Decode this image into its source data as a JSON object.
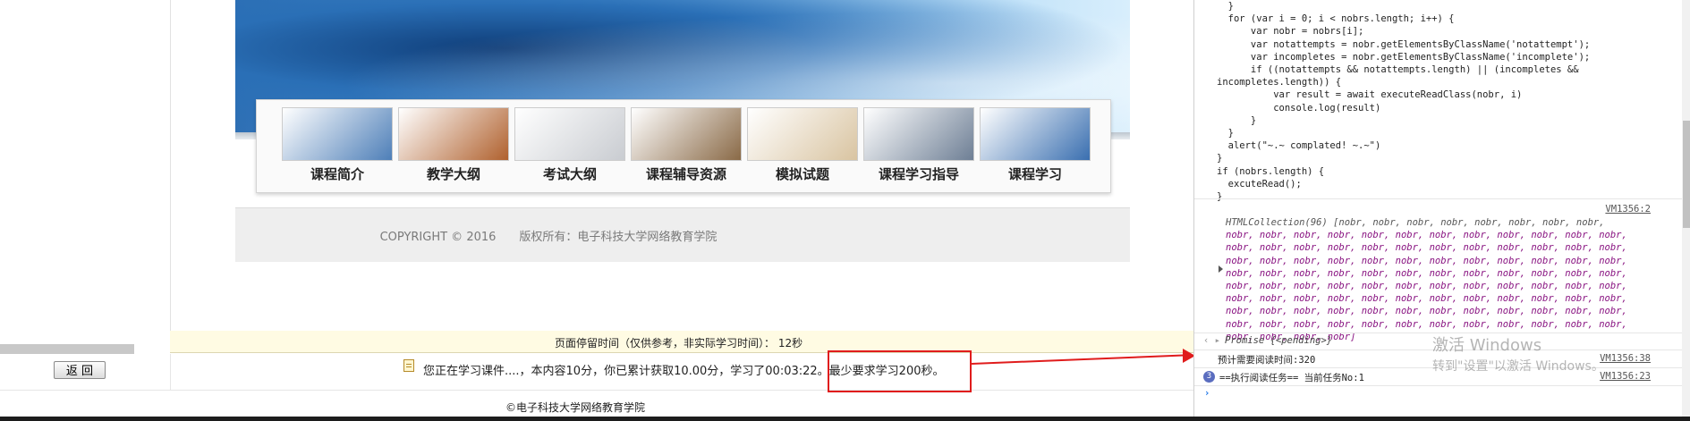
{
  "lms": {
    "menu": [
      {
        "label": "课程简介",
        "icon": "course-intro-image",
        "tint": "#4e7fb8"
      },
      {
        "label": "教学大纲",
        "icon": "syllabus-image",
        "tint": "#b0612e"
      },
      {
        "label": "考试大纲",
        "icon": "exam-outline-image",
        "tint": "#c9ccd1"
      },
      {
        "label": "课程辅导资源",
        "icon": "tutoring-resources-image",
        "tint": "#8a6a47"
      },
      {
        "label": "模拟试题",
        "icon": "mock-exam-image",
        "tint": "#d9c4a1"
      },
      {
        "label": "课程学习指导",
        "icon": "study-guide-image",
        "tint": "#6e7f95"
      },
      {
        "label": "课程学习",
        "icon": "course-study-image",
        "tint": "#3a6fb0"
      }
    ],
    "copyright": "COPYRIGHT © 2016　　版权所有：电子科技大学网络教育学院",
    "stay_time": "页面停留时间（仅供参考，非实际学习时间）： 12秒",
    "back_label": "返 回",
    "status_text": "您正在学习课件....，本内容10分，你已累计获取10.00分，学习了00:03:22。最少要求学习200秒。",
    "bottom_copyright": "©电子科技大学网络教育学院",
    "highlight_color": "#e01c1c"
  },
  "devtools": {
    "code_lines": [
      "  }",
      "  for (var i = 0; i < nobrs.length; i++) {",
      "      var nobr = nobrs[i];",
      "      var notattempts = nobr.getElementsByClassName('notattempt');",
      "      var incompletes = nobr.getElementsByClassName('incomplete');",
      "      if ((notattempts && notattempts.length) || (incompletes &&",
      "incompletes.length)) {",
      "          var result = await executeReadClass(nobr, i)",
      "          console.log(result)",
      "      }",
      "  }",
      "  alert(\"~.~ complated! ~.~\")",
      "}",
      "if (nobrs.length) {",
      "  excuteRead();",
      "}"
    ],
    "htmlcollection_head": "HTMLCollection(96) [nobr, nobr, nobr, nobr, nobr, nobr, nobr, nobr,",
    "htmlcollection_row": "nobr, nobr, nobr, nobr, nobr, nobr, nobr, nobr, nobr, nobr, nobr, nobr,",
    "htmlcollection_tail": "nobr, nobr, nobr, nobr]",
    "htmlcollection_link": "VM1356:2",
    "promise_text": "Promise {<pending>}",
    "log1_text": "预计需要阅读时间:320",
    "log1_link": "VM1356:38",
    "log2_count": "3",
    "log2_text": "==执行阅读任务== 当前任务No:1",
    "log2_link": "VM1356:23",
    "watermark_title": "激活 Windows",
    "watermark_sub": "转到\"设置\"以激活 Windows。"
  }
}
